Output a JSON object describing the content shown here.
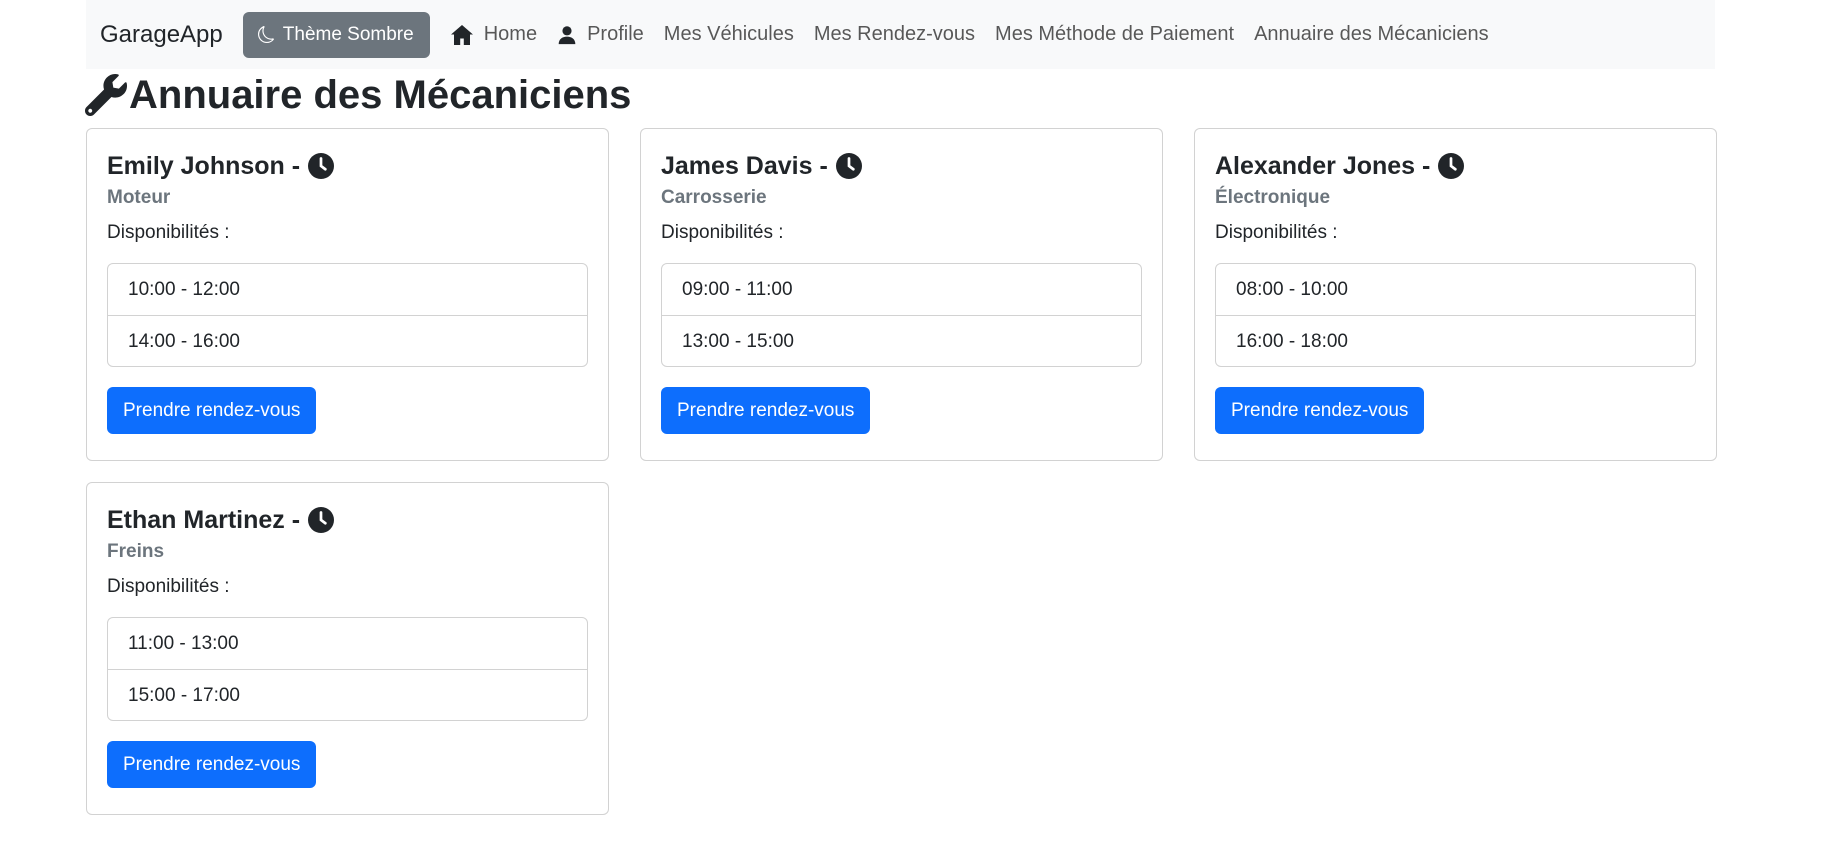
{
  "navbar": {
    "brand": "GarageApp",
    "theme_button": "Thème Sombre",
    "links": [
      {
        "label": "Home",
        "icon": "home-icon"
      },
      {
        "label": "Profile",
        "icon": "user-icon"
      },
      {
        "label": "Mes Véhicules"
      },
      {
        "label": "Mes Rendez-vous"
      },
      {
        "label": "Mes Méthode de Paiement"
      },
      {
        "label": "Annuaire des Mécaniciens"
      }
    ]
  },
  "page": {
    "title": "Annuaire des Mécaniciens",
    "title_icon": "wrench-icon"
  },
  "mechanics": [
    {
      "name": "Emily Johnson -",
      "specialty": "Moteur",
      "availability_label": "Disponibilités :",
      "slots": [
        "10:00 - 12:00",
        "14:00 - 16:00"
      ],
      "button": "Prendre rendez-vous"
    },
    {
      "name": "James Davis -",
      "specialty": "Carrosserie",
      "availability_label": "Disponibilités :",
      "slots": [
        "09:00 - 11:00",
        "13:00 - 15:00"
      ],
      "button": "Prendre rendez-vous"
    },
    {
      "name": "Alexander Jones -",
      "specialty": "Électronique",
      "availability_label": "Disponibilités :",
      "slots": [
        "08:00 - 10:00",
        "16:00 - 18:00"
      ],
      "button": "Prendre rendez-vous"
    },
    {
      "name": "Ethan Martinez -",
      "specialty": "Freins",
      "availability_label": "Disponibilités :",
      "slots": [
        "11:00 - 13:00",
        "15:00 - 17:00"
      ],
      "button": "Prendre rendez-vous"
    }
  ],
  "colors": {
    "primary": "#0d6efd",
    "secondary": "#6c757d",
    "navbar_bg": "#f8f9fa",
    "text": "#212529"
  }
}
